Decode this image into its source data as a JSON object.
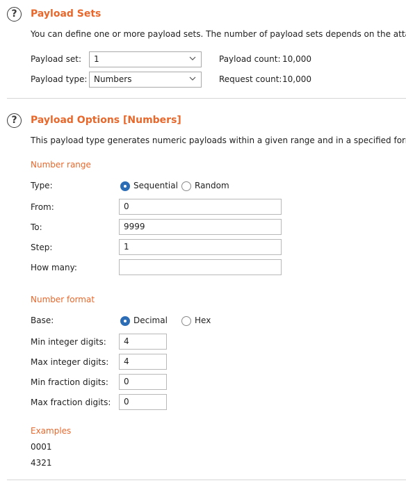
{
  "payload_sets": {
    "title": "Payload Sets",
    "description": "You can define one or more payload sets. The number of payload sets depends on the attac",
    "payload_set_label": "Payload set:",
    "payload_set_value": "1",
    "payload_type_label": "Payload type:",
    "payload_type_value": "Numbers",
    "payload_count_label": "Payload count:",
    "payload_count_value": "10,000",
    "request_count_label": "Request count:",
    "request_count_value": "10,000"
  },
  "payload_options": {
    "title": "Payload Options [Numbers]",
    "description": "This payload type generates numeric payloads within a given range and in a specified forma",
    "number_range": {
      "heading": "Number range",
      "type_label": "Type:",
      "type_options": [
        "Sequential",
        "Random"
      ],
      "type_selected": "Sequential",
      "from_label": "From:",
      "from_value": "0",
      "to_label": "To:",
      "to_value": "9999",
      "step_label": "Step:",
      "step_value": "1",
      "how_many_label": "How many:",
      "how_many_value": ""
    },
    "number_format": {
      "heading": "Number format",
      "base_label": "Base:",
      "base_options": [
        "Decimal",
        "Hex"
      ],
      "base_selected": "Decimal",
      "min_int_label": "Min integer digits:",
      "min_int_value": "4",
      "max_int_label": "Max integer digits:",
      "max_int_value": "4",
      "min_frac_label": "Min fraction digits:",
      "min_frac_value": "0",
      "max_frac_label": "Max fraction digits:",
      "max_frac_value": "0"
    },
    "examples": {
      "heading": "Examples",
      "items": [
        "0001",
        "4321"
      ]
    }
  },
  "colors": {
    "accent": "#e8682c",
    "radio_selected": "#2d6db5"
  },
  "icons": {
    "help": "help-circle-icon",
    "dropdown": "chevron-down-icon"
  }
}
